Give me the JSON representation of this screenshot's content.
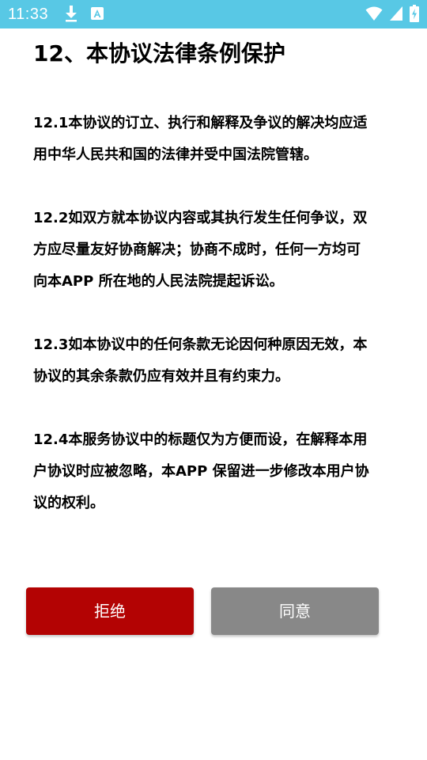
{
  "status_bar": {
    "time": "11:33",
    "background": "#58c8e5",
    "left_icons": [
      "download-icon",
      "font-app-icon"
    ],
    "right_icons": [
      "wifi-icon",
      "signal-icon",
      "battery-charging-icon"
    ]
  },
  "title": "12、本协议法律条例保护",
  "sections": [
    {
      "lines": [
        "12.1本协议的订立、执行和解释及争议的解决均应适",
        "用中华人民共和国的法律并受中国法院管辖。"
      ]
    },
    {
      "lines": [
        "12.2如双方就本协议内容或其执行发生任何争议，双",
        "方应尽量友好协商解决；协商不成时，任何一方均可",
        "向本APP 所在地的人民法院提起诉讼。"
      ]
    },
    {
      "lines": [
        "12.3如本协议中的任何条款无论因何种原因无效，本",
        "协议的其余条款仍应有效并且有约束力。"
      ]
    },
    {
      "lines": [
        "12.4本服务协议中的标题仅为方便而设，在解释本用",
        "户协议时应被忽略，本APP 保留进一步修改本用户协",
        "议的权利。"
      ]
    }
  ],
  "buttons": {
    "reject_label": "拒绝",
    "agree_label": "同意",
    "reject_color": "#b30303",
    "agree_color": "#888888"
  }
}
